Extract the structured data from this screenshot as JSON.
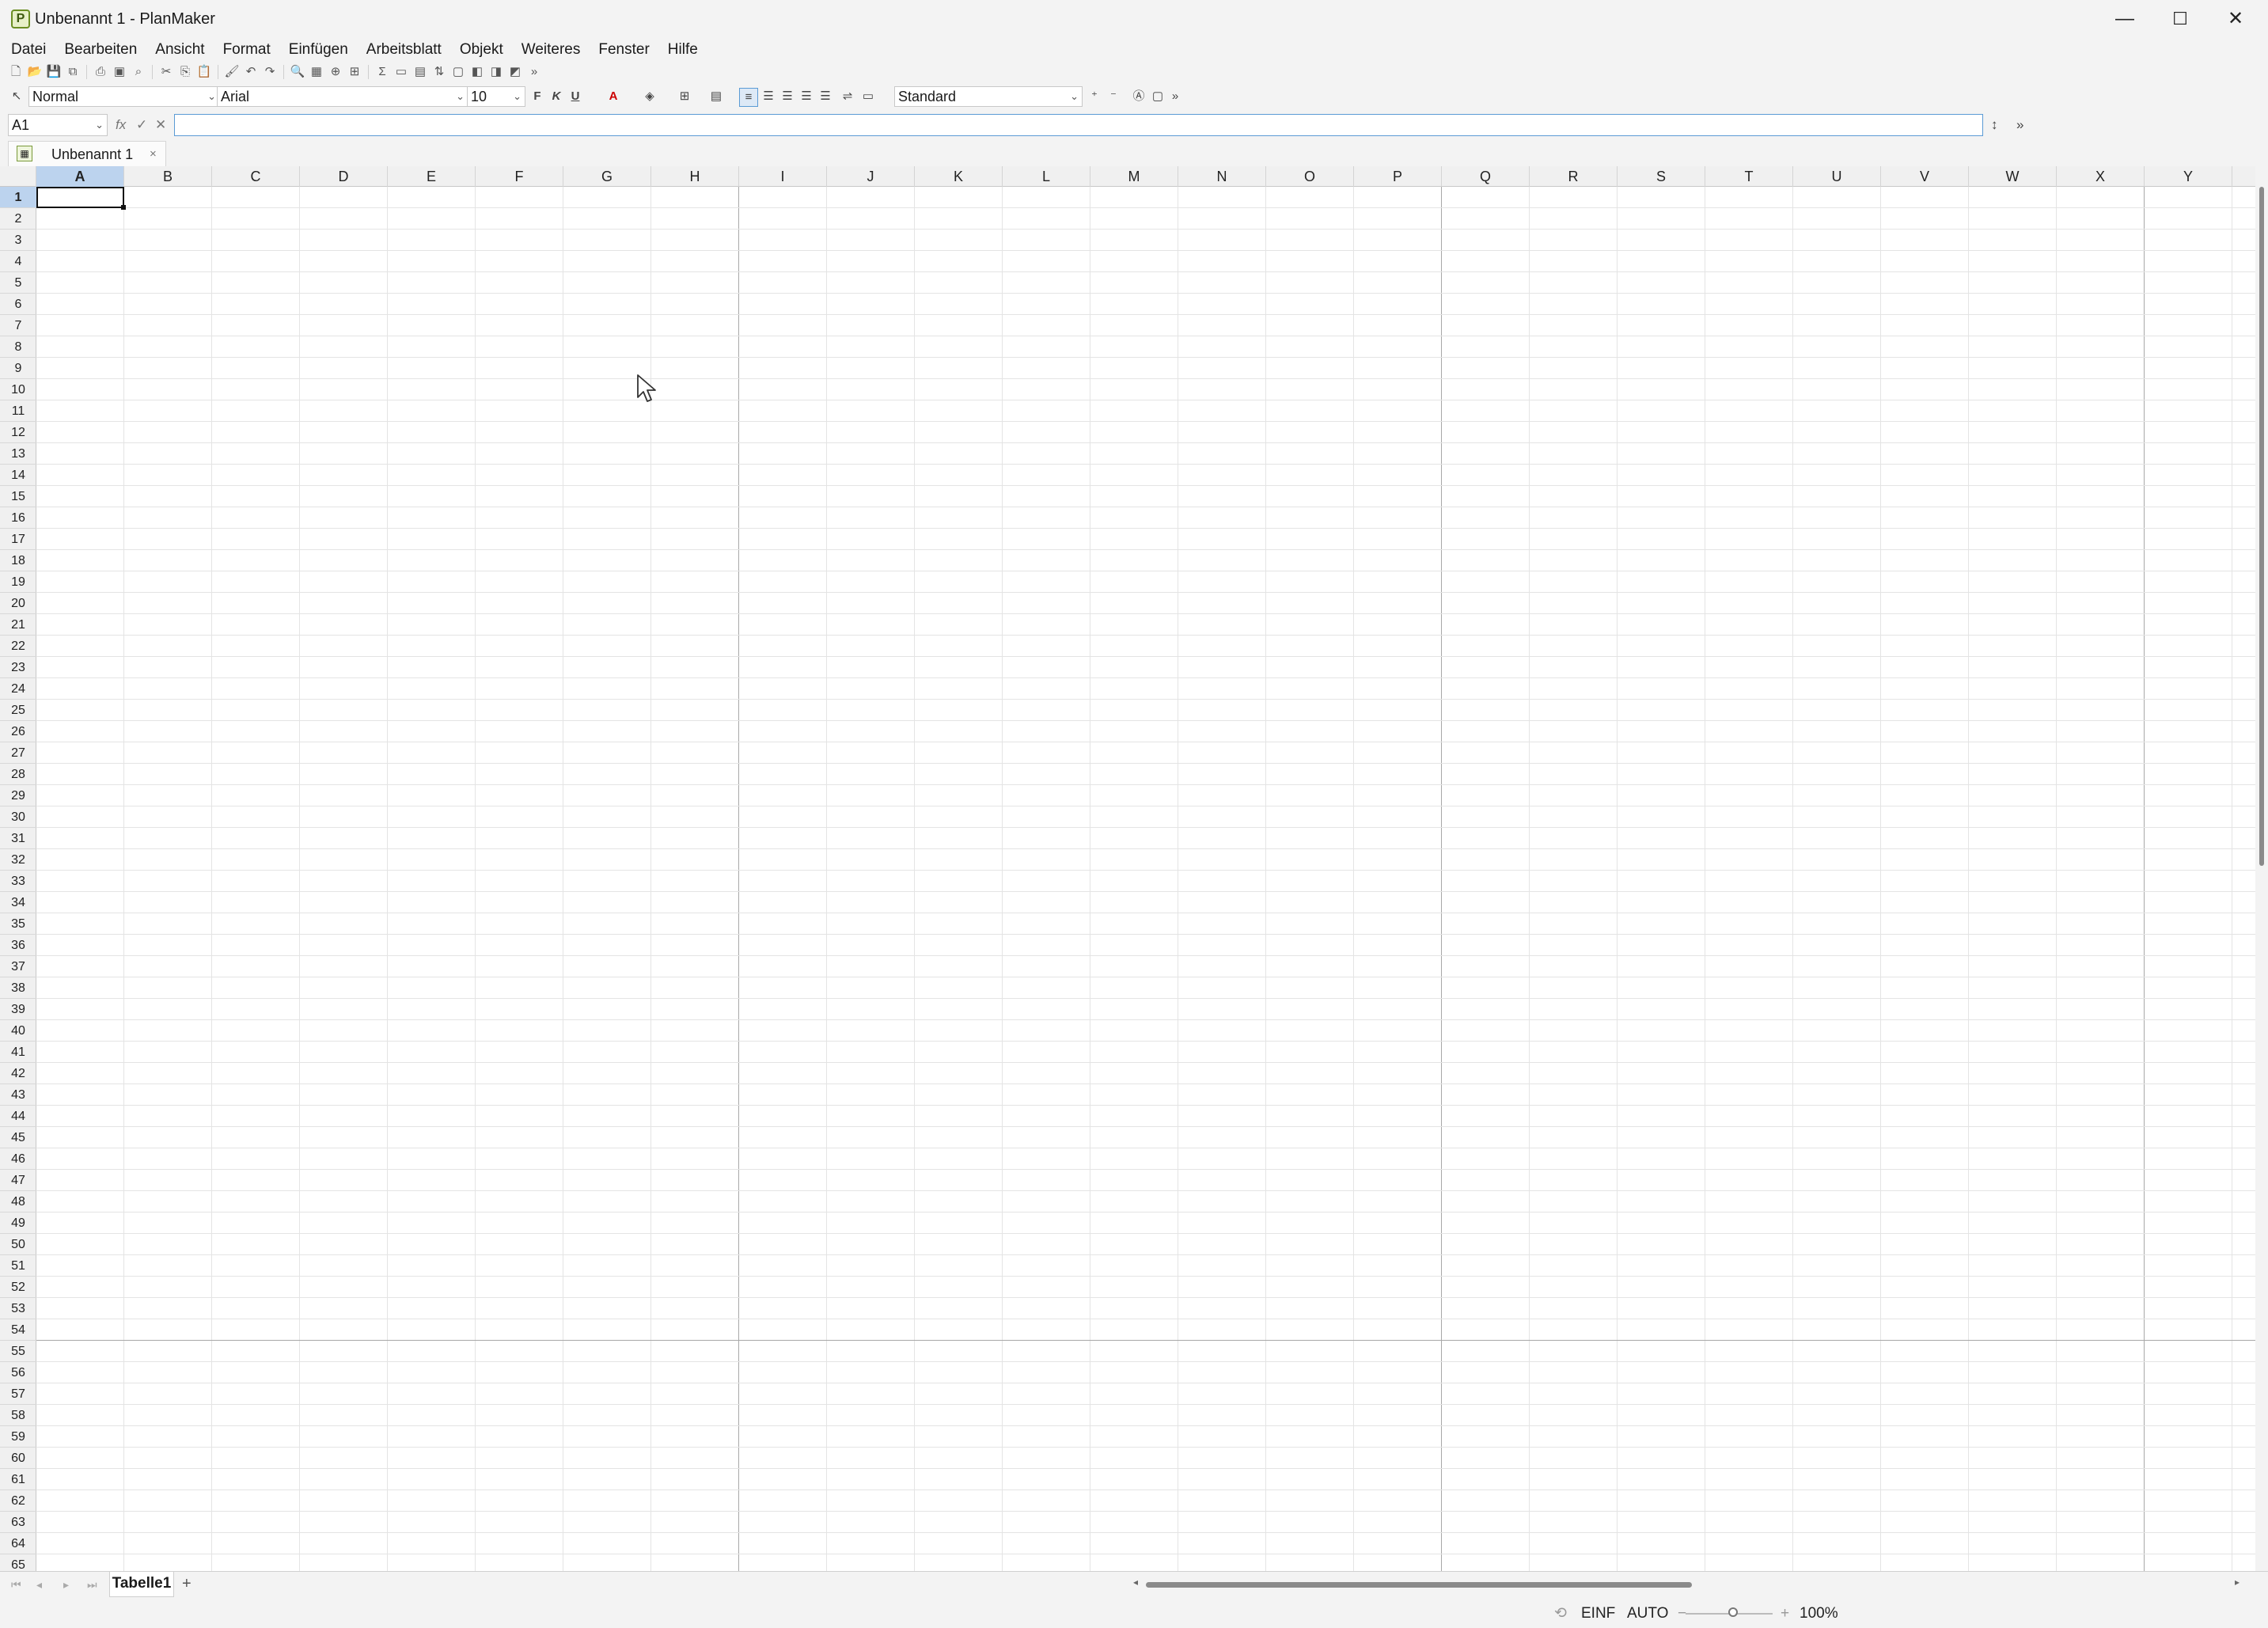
{
  "window": {
    "title": "Unbenannt 1 - PlanMaker",
    "app_icon_letter": "P",
    "minimize": "—",
    "maximize": "☐",
    "close": "✕"
  },
  "menu": {
    "items": [
      "Datei",
      "Bearbeiten",
      "Ansicht",
      "Format",
      "Einfügen",
      "Arbeitsblatt",
      "Objekt",
      "Weiteres",
      "Fenster",
      "Hilfe"
    ]
  },
  "format_bar": {
    "style": "Normal",
    "font": "Arial",
    "size": "10",
    "bold": "F",
    "italic": "K",
    "underline": "U",
    "number_format": "Standard"
  },
  "formula_bar": {
    "cell_ref": "A1",
    "fx": "fx",
    "value": ""
  },
  "doc_tab": {
    "label": "Unbenannt 1",
    "close": "×"
  },
  "grid": {
    "columns": [
      "A",
      "B",
      "C",
      "D",
      "E",
      "F",
      "G",
      "H",
      "I",
      "J",
      "K",
      "L",
      "M",
      "N",
      "O",
      "P",
      "Q",
      "R",
      "S",
      "T",
      "U",
      "V",
      "W",
      "X",
      "Y"
    ],
    "row_count": 65,
    "selected_cell": "A1"
  },
  "sheets": {
    "tabs": [
      "Tabelle1"
    ],
    "add": "+"
  },
  "status": {
    "mode_insert": "EINF",
    "mode_calc": "AUTO",
    "zoom_minus": "−",
    "zoom_plus": "+",
    "zoom": "100%"
  },
  "colors": {
    "accent": "#5b9bd5",
    "selected_header": "#bcd3ee",
    "page_break": "#a8a8a8"
  }
}
